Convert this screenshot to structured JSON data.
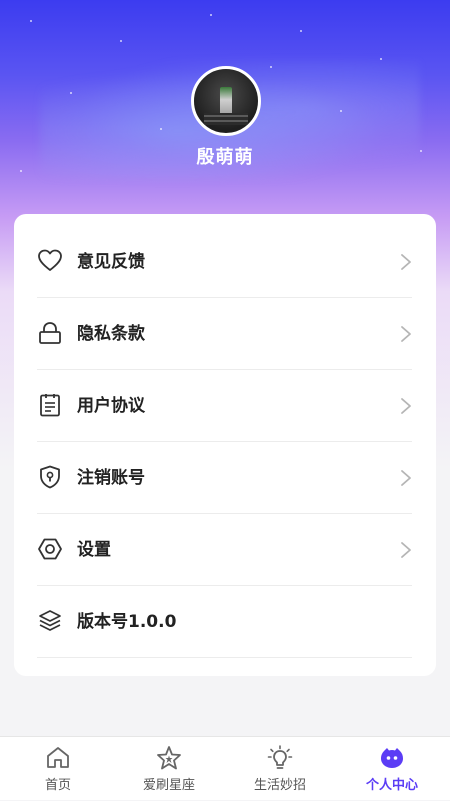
{
  "profile": {
    "username": "殷萌萌"
  },
  "menu": {
    "items": [
      {
        "label": "意见反馈",
        "icon": "heart-icon"
      },
      {
        "label": "隐私条款",
        "icon": "lock-icon"
      },
      {
        "label": "用户协议",
        "icon": "document-icon"
      },
      {
        "label": "注销账号",
        "icon": "shield-icon"
      },
      {
        "label": "设置",
        "icon": "hexagon-settings-icon"
      },
      {
        "label": "版本号1.0.0",
        "icon": "layers-icon"
      }
    ]
  },
  "tabbar": {
    "items": [
      {
        "label": "首页",
        "icon": "home-icon"
      },
      {
        "label": "爱刷星座",
        "icon": "star-icon"
      },
      {
        "label": "生活妙招",
        "icon": "lightbulb-icon"
      },
      {
        "label": "个人中心",
        "icon": "face-icon",
        "active": true
      }
    ],
    "active_color": "#5b3df5",
    "inactive_color": "#555555"
  },
  "theme": {
    "gradient_top": "#3c3cf0",
    "gradient_mid": "#c69bf4",
    "background": "#f4f4f6"
  }
}
